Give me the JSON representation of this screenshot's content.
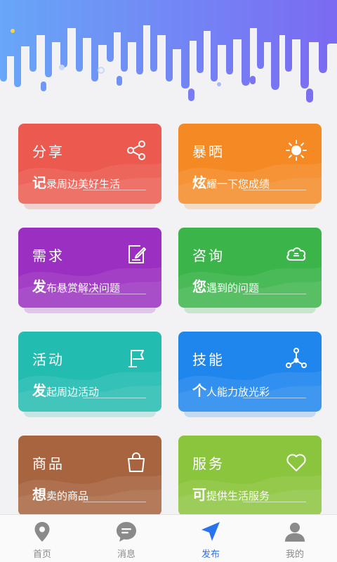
{
  "colors": {
    "header_gradient_start": "#6aa1f6",
    "header_gradient_end": "#7b6cf2",
    "active_nav": "#2a73f0",
    "inactive_nav": "#8a8a8a"
  },
  "tiles": [
    {
      "title": "分享",
      "sub_first": "记",
      "sub_rest": "录周边美好生活",
      "icon": "share-icon",
      "color": "#ec5a4f"
    },
    {
      "title": "暴晒",
      "sub_first": "炫",
      "sub_rest": "耀一下您成绩",
      "icon": "sun-icon",
      "color": "#f58a25"
    },
    {
      "title": "需求",
      "sub_first": "发",
      "sub_rest": "布悬赏解决问题",
      "icon": "edit-icon",
      "color": "#9b2fc1"
    },
    {
      "title": "咨询",
      "sub_first": "您",
      "sub_rest": "遇到的问题",
      "icon": "chat-cloud-icon",
      "color": "#3bb54a"
    },
    {
      "title": "活动",
      "sub_first": "发",
      "sub_rest": "起周边活动",
      "icon": "flag-icon",
      "color": "#23bcb1"
    },
    {
      "title": "技能",
      "sub_first": "个",
      "sub_rest": "人能力放光彩",
      "icon": "network-icon",
      "color": "#1f86ee"
    },
    {
      "title": "商品",
      "sub_first": "想",
      "sub_rest": "卖的商品",
      "icon": "shopping-bag-icon",
      "color": "#a8643f"
    },
    {
      "title": "服务",
      "sub_first": "可",
      "sub_rest": "提供生活服务",
      "icon": "heart-icon",
      "color": "#8bc53d"
    }
  ],
  "nav": [
    {
      "label": "首页",
      "icon": "location-pin-icon",
      "active": false
    },
    {
      "label": "消息",
      "icon": "message-icon",
      "active": false
    },
    {
      "label": "发布",
      "icon": "send-icon",
      "active": true
    },
    {
      "label": "我的",
      "icon": "user-icon",
      "active": false
    }
  ]
}
